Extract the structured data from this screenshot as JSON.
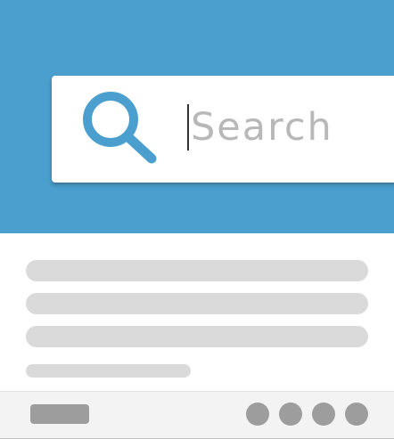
{
  "hero": {
    "background_color": "#4b9fce"
  },
  "search": {
    "icon": "search-icon",
    "placeholder": "Search",
    "value": "",
    "icon_color": "#4b9fce"
  },
  "content": {
    "skeleton_lines": 4
  },
  "footer": {
    "button_icon": "pill-button",
    "dots": [
      "dot",
      "dot",
      "dot",
      "dot"
    ]
  }
}
